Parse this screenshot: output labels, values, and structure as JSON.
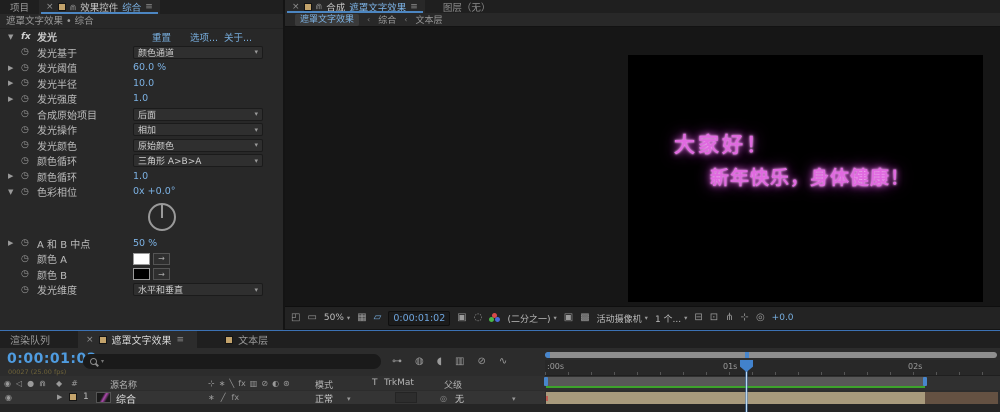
{
  "ui": {
    "close_glyph": "×",
    "menu_glyph": "≡",
    "chevron": "▾",
    "accent": "#78b0e2"
  },
  "effect_panel": {
    "tabs": {
      "project": "项目",
      "panel_title": "效果控件",
      "comp_name": "综合"
    },
    "source_label": "遮罩文字效果 • 综合",
    "header": {
      "fx": "fx",
      "name": "发光",
      "reset": "重置",
      "options": "选项...",
      "about": "关于..."
    },
    "rows": [
      {
        "type": "dropdown",
        "label": "发光基于",
        "value": "颜色通道"
      },
      {
        "type": "value",
        "label": "发光阈值",
        "value": "60.0 %",
        "expander": true
      },
      {
        "type": "value",
        "label": "发光半径",
        "value": "10.0",
        "expander": true
      },
      {
        "type": "value",
        "label": "发光强度",
        "value": "1.0",
        "expander": true
      },
      {
        "type": "dropdown",
        "label": "合成原始项目",
        "value": "后面"
      },
      {
        "type": "dropdown",
        "label": "发光操作",
        "value": "相加"
      },
      {
        "type": "dropdown",
        "label": "发光颜色",
        "value": "原始颜色"
      },
      {
        "type": "dropdown",
        "label": "颜色循环",
        "value": "三角形 A>B>A"
      },
      {
        "type": "value",
        "label": "颜色循环",
        "value": "1.0",
        "expander": true
      },
      {
        "type": "value",
        "label": "色彩相位",
        "value": "0x +0.0°",
        "expander": "open"
      },
      {
        "type": "dial"
      },
      {
        "type": "value",
        "label": "A 和 B 中点",
        "value": "50 %",
        "expander": true
      },
      {
        "type": "color",
        "label": "颜色 A",
        "swatch": "#ffffff"
      },
      {
        "type": "color",
        "label": "颜色 B",
        "swatch": "#000000"
      },
      {
        "type": "dropdown",
        "label": "发光维度",
        "value": "水平和垂直"
      }
    ]
  },
  "viewer": {
    "tab": {
      "kind": "合成",
      "name": "遮罩文字效果"
    },
    "layer_tab": "图层（无）",
    "breadcrumb": {
      "current": "遮罩文字效果",
      "sep": "‹",
      "parent": "综合",
      "leaf": "文本层"
    },
    "canvas": {
      "line1": "大家好！",
      "line2": "新年快乐，身体健康！",
      "text_color": "#e06ae0"
    },
    "toolbar_items": [
      {
        "type": "icon",
        "name": "snapshot-views-icon",
        "glyph": "◰"
      },
      {
        "type": "icon",
        "name": "monitor-icon",
        "glyph": "▭"
      },
      {
        "type": "select",
        "name": "magnification-select",
        "label": "50%"
      },
      {
        "type": "icon",
        "name": "grid-guides-icon",
        "glyph": "▦"
      },
      {
        "type": "icon",
        "name": "roi-icon",
        "glyph": "▱",
        "color": "#78b0e2"
      },
      {
        "type": "timecode",
        "name": "preview-timecode",
        "label": "0:00:01:02"
      },
      {
        "type": "icon",
        "name": "snapshot-camera-icon",
        "glyph": "▣"
      },
      {
        "type": "icon",
        "name": "show-snapshot-icon",
        "glyph": "◌"
      },
      {
        "type": "rgb",
        "name": "channels-icon",
        "colors": [
          "#d84a4a",
          "#49b849",
          "#4a6ad8"
        ]
      },
      {
        "type": "select",
        "name": "resolution-select",
        "label": "(二分之一)"
      },
      {
        "type": "icon",
        "name": "region-of-interest-icon",
        "glyph": "▣"
      },
      {
        "type": "icon",
        "name": "transparency-grid-icon",
        "glyph": "▩"
      },
      {
        "type": "select",
        "name": "camera-select",
        "label": "活动摄像机"
      },
      {
        "type": "select",
        "name": "view-count-select",
        "label": "1 个..."
      },
      {
        "type": "icon",
        "name": "view-layout-icon",
        "glyph": "⊟"
      },
      {
        "type": "icon",
        "name": "preview-frame-icon",
        "glyph": "⊡"
      },
      {
        "type": "icon",
        "name": "flowchart-icon",
        "glyph": "⋔"
      },
      {
        "type": "icon",
        "name": "mini-flowchart-icon",
        "glyph": "⊹"
      },
      {
        "type": "icon",
        "name": "exposure-gear-icon",
        "glyph": "◎"
      },
      {
        "type": "text",
        "name": "exposure-value",
        "label": "+0.0",
        "color": "#78b0e2"
      }
    ]
  },
  "timeline": {
    "tabs": {
      "render_queue": "渲染队列",
      "active": "遮罩文字效果",
      "other": "文本层"
    },
    "timecode": "0:00:01:02",
    "frame_info": "00027 (25.00 fps)",
    "tools": [
      {
        "name": "comp-mini-flowchart-icon",
        "glyph": "⊶"
      },
      {
        "name": "draft-3d-icon",
        "glyph": "◍"
      },
      {
        "name": "shy-icon",
        "glyph": "◖"
      },
      {
        "name": "frame-blend-icon",
        "glyph": "▥"
      },
      {
        "name": "motion-blur-icon",
        "glyph": "⊘"
      },
      {
        "name": "graph-editor-icon",
        "glyph": "∿"
      }
    ],
    "av_icons": [
      {
        "name": "video-eye-icon",
        "glyph": "◉"
      },
      {
        "name": "audio-icon",
        "glyph": "◁"
      },
      {
        "name": "solo-icon",
        "glyph": "●"
      },
      {
        "name": "lock-icon",
        "glyph": "⋒"
      }
    ],
    "tag_icons": [
      {
        "name": "label-icon",
        "glyph": "◆"
      },
      {
        "name": "index-icon",
        "glyph": "#"
      }
    ],
    "switch_icons": [
      {
        "name": "shy-column-icon",
        "glyph": "⊹"
      },
      {
        "name": "collapse-column-icon",
        "glyph": "∗"
      },
      {
        "name": "quality-column-icon",
        "glyph": "╲"
      },
      {
        "name": "effects-column-icon",
        "glyph": "fx"
      },
      {
        "name": "frame-blend-column-icon",
        "glyph": "▥"
      },
      {
        "name": "motion-blur-column-icon",
        "glyph": "⊘"
      },
      {
        "name": "adjustment-column-icon",
        "glyph": "◐"
      },
      {
        "name": "threed-column-icon",
        "glyph": "⊛"
      }
    ],
    "layer_switch_icons": [
      {
        "name": "collapse-switch-icon",
        "glyph": "∗"
      },
      {
        "name": "quality-switch-icon",
        "glyph": "╱"
      },
      {
        "name": "effects-switch-icon",
        "glyph": "fx"
      }
    ],
    "columns": {
      "source_name": "源名称",
      "mode": "模式",
      "t": "T",
      "trkmat": "TrkMat",
      "parent": "父级"
    },
    "layer": {
      "number": "1",
      "name": "综合",
      "mode": "正常",
      "parent": "无"
    },
    "ruler": {
      "t0": ":00s",
      "t1": "01s",
      "t2": "02s"
    }
  }
}
